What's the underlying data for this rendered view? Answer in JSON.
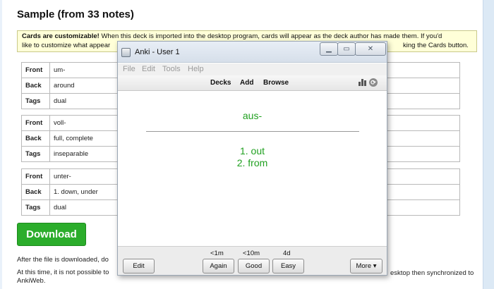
{
  "page": {
    "title": "Sample (from 33 notes)",
    "notice": {
      "bold": "Cards are customizable!",
      "line1": " When this deck is imported into the desktop program, cards will appear as the deck author has made them. If you'd",
      "line2_left": "like to customize what appear",
      "line2_right": "king the Cards button."
    },
    "notes": [
      {
        "rows": [
          {
            "key": "Front",
            "value": "um-"
          },
          {
            "key": "Back",
            "value": "around"
          },
          {
            "key": "Tags",
            "value": "dual"
          }
        ]
      },
      {
        "rows": [
          {
            "key": "Front",
            "value": "voll-"
          },
          {
            "key": "Back",
            "value": "full, complete"
          },
          {
            "key": "Tags",
            "value": "inseparable"
          }
        ]
      },
      {
        "rows": [
          {
            "key": "Front",
            "value": "unter-"
          },
          {
            "key": "Back",
            "value": "1. down, under"
          },
          {
            "key": "Tags",
            "value": "dual"
          }
        ]
      }
    ],
    "download_label": "Download",
    "after_text": "After the file is downloaded, do",
    "time_text_a": "At this time, it is not possible to",
    "time_text_b": "AnkiWeb.",
    "time_text_right": "esktop then synchronized to"
  },
  "anki": {
    "window_title": "Anki - User 1",
    "menu": [
      "File",
      "Edit",
      "Tools",
      "Help"
    ],
    "toolbar": [
      "Decks",
      "Add",
      "Browse"
    ],
    "card": {
      "front": "aus-",
      "back_line1": "1. out",
      "back_line2": "2. from",
      "text_color": "#20a020"
    },
    "bottom": {
      "edit_label": "Edit",
      "intervals": [
        "<1m",
        "<10m",
        "4d"
      ],
      "answers": [
        "Again",
        "Good",
        "Easy"
      ],
      "more_label": "More ▾"
    },
    "icons": [
      "app-icon",
      "minimize-icon",
      "maximize-icon",
      "close-icon",
      "stats-icon",
      "sync-icon"
    ]
  },
  "colors": {
    "download_green": "#2bad2b",
    "notice_bg": "#ffffd8",
    "card_green": "#20a020"
  }
}
